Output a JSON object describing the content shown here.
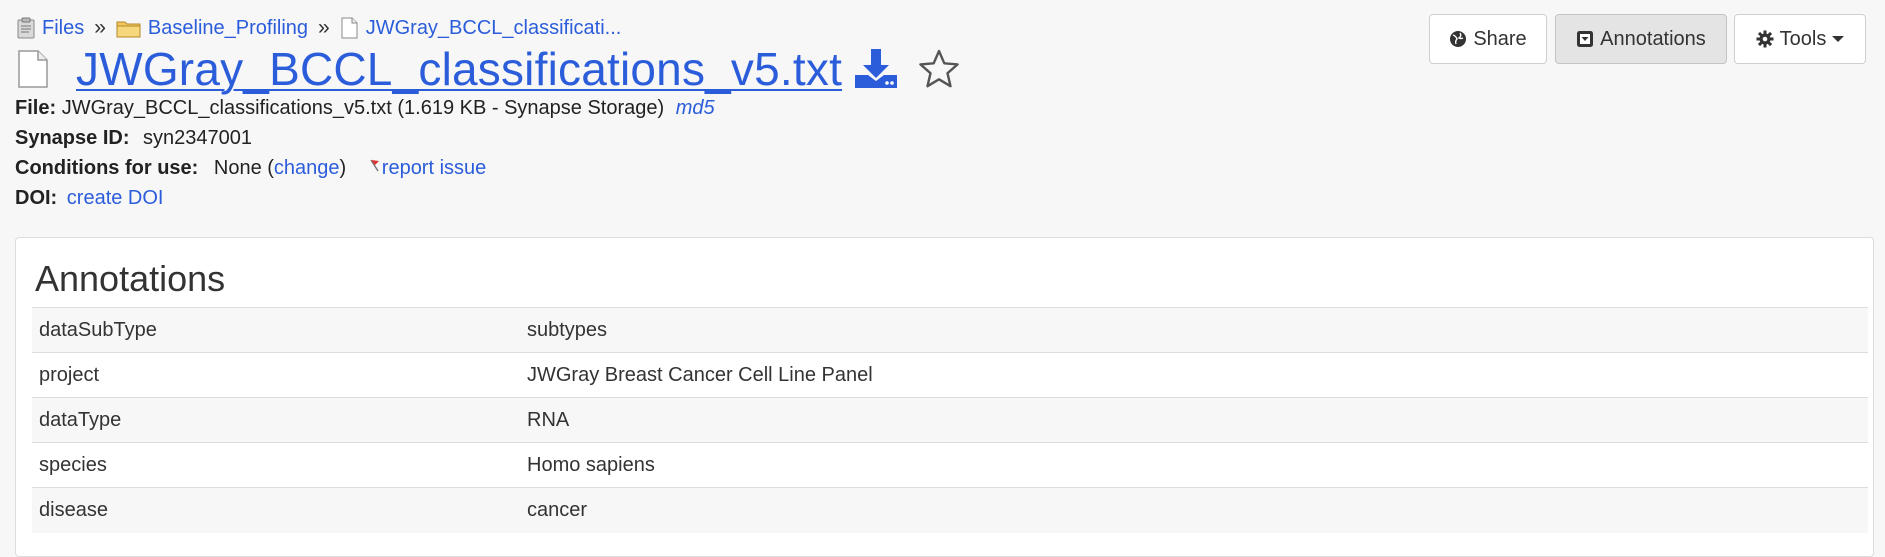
{
  "breadcrumb": {
    "items": [
      {
        "label": "Files",
        "icon": "clipboard-icon"
      },
      {
        "label": "Baseline_Profiling",
        "icon": "folder-icon"
      },
      {
        "label": "JWGray_BCCL_classificati...",
        "icon": "file-icon"
      }
    ],
    "separator": "»"
  },
  "title": {
    "text": "JWGray_BCCL_classifications_v5.txt ",
    "icon": "file-icon"
  },
  "meta": {
    "file_label": "File:",
    "file_value": "JWGray_BCCL_classifications_v5.txt (1.619 KB - Synapse Storage)",
    "md5_link": "md5",
    "synapse_label": "Synapse ID:",
    "synapse_value": "syn2347001",
    "conditions_label": "Conditions for use:",
    "conditions_value": "None (",
    "change_link": "change",
    "conditions_close": ")",
    "report_link": "report issue",
    "doi_label": "DOI:",
    "doi_link": "create DOI"
  },
  "toolbar": {
    "share_label": "Share",
    "annotations_label": "Annotations",
    "tools_label": "Tools"
  },
  "annotations": {
    "title": "Annotations",
    "rows": [
      {
        "key": "dataSubType",
        "value": "subtypes"
      },
      {
        "key": "project",
        "value": "JWGray Breast Cancer Cell Line Panel"
      },
      {
        "key": "dataType",
        "value": "RNA"
      },
      {
        "key": "species",
        "value": "Homo sapiens"
      },
      {
        "key": "disease",
        "value": "cancer"
      }
    ]
  },
  "colors": {
    "link": "#2b5ddb",
    "background": "#f7f7f7",
    "folder": "#e8b84a"
  }
}
